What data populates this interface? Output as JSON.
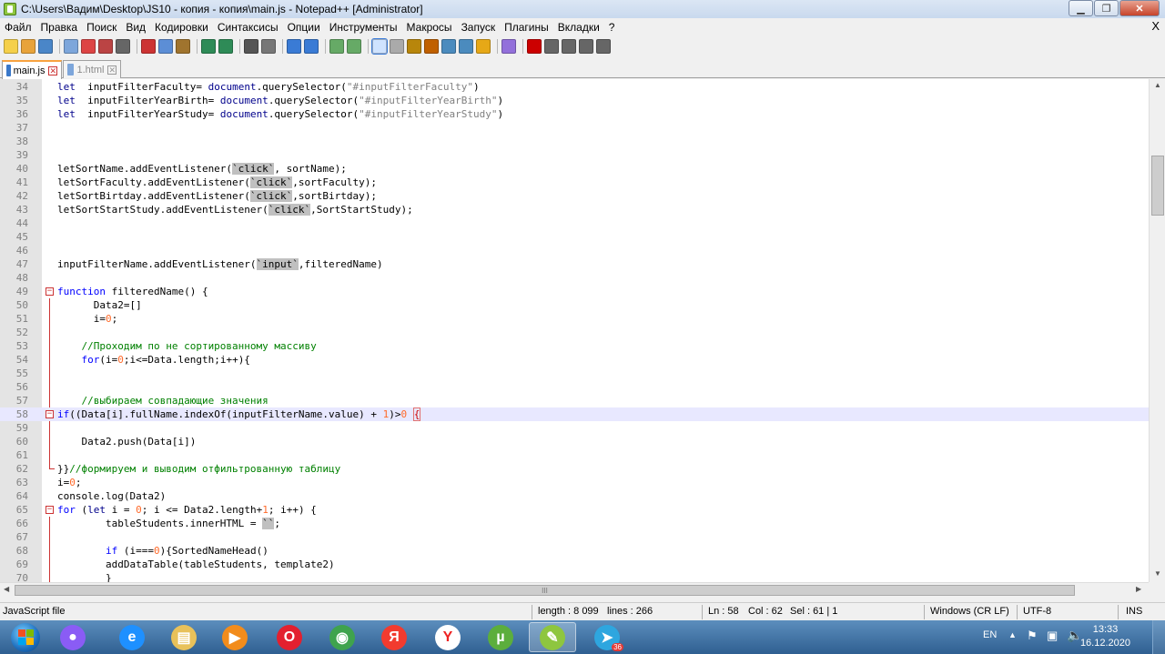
{
  "window": {
    "title": "C:\\Users\\Вадим\\Desktop\\JS10 - копия - копия\\main.js - Notepad++ [Administrator]",
    "minimize_glyph": "▁",
    "maximize_glyph": "❐",
    "close_glyph": "✕"
  },
  "menu": {
    "items": [
      "Файл",
      "Правка",
      "Поиск",
      "Вид",
      "Кодировки",
      "Синтаксисы",
      "Опции",
      "Инструменты",
      "Макросы",
      "Запуск",
      "Плагины",
      "Вкладки",
      "?"
    ],
    "close_glyph": "X"
  },
  "toolbar": {
    "icons": [
      "new-file-icon",
      "open-file-icon",
      "save-icon",
      "save-all-icon",
      "close-icon",
      "close-all-icon",
      "print-icon",
      "cut-icon",
      "copy-icon",
      "paste-icon",
      "undo-icon",
      "redo-icon",
      "find-icon",
      "replace-icon",
      "zoom-in-icon",
      "zoom-out-icon",
      "sync-vertical-icon",
      "sync-horizontal-icon",
      "word-wrap-icon",
      "show-all-chars-icon",
      "indent-guide-icon",
      "user-language-icon",
      "doc-map-icon",
      "function-list-icon",
      "folder-workspace-icon",
      "monitoring-icon",
      "record-macro-icon",
      "stop-record-icon",
      "play-macro-icon",
      "run-macro-multiple-icon",
      "save-macro-icon"
    ]
  },
  "tabs": [
    {
      "label": "main.js",
      "active": true
    },
    {
      "label": "1.html",
      "active": false
    }
  ],
  "editor": {
    "lines": [
      {
        "n": "34",
        "segs": [
          [
            "kw",
            "let"
          ],
          [
            "",
            "  inputFilterFaculty= "
          ],
          [
            "kw",
            "document"
          ],
          [
            "",
            ".querySelector("
          ],
          [
            "str",
            "\"#inputFilterFaculty\""
          ],
          [
            "",
            ")"
          ]
        ]
      },
      {
        "n": "35",
        "segs": [
          [
            "kw",
            "let"
          ],
          [
            "",
            "  inputFilterYearBirth= "
          ],
          [
            "kw",
            "document"
          ],
          [
            "",
            ".querySelector("
          ],
          [
            "str",
            "\"#inputFilterYearBirth\""
          ],
          [
            "",
            ")"
          ]
        ]
      },
      {
        "n": "36",
        "segs": [
          [
            "kw",
            "let"
          ],
          [
            "",
            "  inputFilterYearStudy= "
          ],
          [
            "kw",
            "document"
          ],
          [
            "",
            ".querySelector("
          ],
          [
            "str",
            "\"#inputFilterYearStudy\""
          ],
          [
            "",
            ")"
          ]
        ]
      },
      {
        "n": "37",
        "segs": []
      },
      {
        "n": "38",
        "segs": []
      },
      {
        "n": "39",
        "segs": []
      },
      {
        "n": "40",
        "segs": [
          [
            "",
            "letSortName.addEventListener("
          ],
          [
            "hl",
            "`click`"
          ],
          [
            "",
            ", sortName);"
          ]
        ]
      },
      {
        "n": "41",
        "segs": [
          [
            "",
            "letSortFaculty.addEventListener("
          ],
          [
            "hl",
            "`click`"
          ],
          [
            "",
            ",sortFaculty);"
          ]
        ]
      },
      {
        "n": "42",
        "segs": [
          [
            "",
            "letSortBirtday.addEventListener("
          ],
          [
            "hl",
            "`click`"
          ],
          [
            "",
            ",sortBirtday);"
          ]
        ]
      },
      {
        "n": "43",
        "segs": [
          [
            "",
            "letSortStartStudy.addEventListener("
          ],
          [
            "hl",
            "`click`"
          ],
          [
            "",
            ",SortStartStudy);"
          ]
        ]
      },
      {
        "n": "44",
        "segs": []
      },
      {
        "n": "45",
        "segs": []
      },
      {
        "n": "46",
        "segs": []
      },
      {
        "n": "47",
        "segs": [
          [
            "",
            "inputFilterName.addEventListener("
          ],
          [
            "hl",
            "`input`"
          ],
          [
            "",
            ",filteredName)"
          ]
        ]
      },
      {
        "n": "48",
        "segs": []
      },
      {
        "n": "49",
        "fold": "open",
        "segs": [
          [
            "kw2",
            "function"
          ],
          [
            "",
            " filteredName() {"
          ]
        ]
      },
      {
        "n": "50",
        "guide": true,
        "segs": [
          [
            "",
            "      Data2=[]"
          ]
        ]
      },
      {
        "n": "51",
        "guide": true,
        "segs": [
          [
            "",
            "      i="
          ],
          [
            "num",
            "0"
          ],
          [
            "",
            ";"
          ]
        ]
      },
      {
        "n": "52",
        "guide": true,
        "segs": []
      },
      {
        "n": "53",
        "guide": true,
        "segs": [
          [
            "cmt",
            "    //Проходим по не сортированному массиву"
          ]
        ]
      },
      {
        "n": "54",
        "guide": true,
        "segs": [
          [
            "kw2",
            "    for"
          ],
          [
            "",
            "(i="
          ],
          [
            "num",
            "0"
          ],
          [
            "",
            ";i<=Data.length;i++){"
          ]
        ]
      },
      {
        "n": "55",
        "guide": true,
        "segs": []
      },
      {
        "n": "56",
        "guide": true,
        "segs": []
      },
      {
        "n": "57",
        "guide": true,
        "segs": [
          [
            "cmt",
            "    //выбираем совпадающие значения"
          ]
        ]
      },
      {
        "n": "58",
        "fold": "open",
        "current": true,
        "segs": [
          [
            "kw2",
            "if"
          ],
          [
            "",
            "((Data[i].fullName.indexOf(inputFilterName.value) + "
          ],
          [
            "num",
            "1"
          ],
          [
            "",
            ")>"
          ],
          [
            "num",
            "0"
          ],
          [
            "",
            " "
          ],
          [
            "br",
            "{"
          ]
        ]
      },
      {
        "n": "59",
        "guide": true,
        "segs": []
      },
      {
        "n": "60",
        "guide": true,
        "segs": [
          [
            "",
            "    Data2.push(Data[i])"
          ]
        ]
      },
      {
        "n": "61",
        "guide": true,
        "segs": []
      },
      {
        "n": "62",
        "end": true,
        "segs": [
          [
            "",
            "}}"
          ],
          [
            "cmt",
            "//формируем и выводим отфильтрованную таблицу"
          ]
        ]
      },
      {
        "n": "63",
        "segs": [
          [
            "",
            "i="
          ],
          [
            "num",
            "0"
          ],
          [
            "",
            ";"
          ]
        ]
      },
      {
        "n": "64",
        "segs": [
          [
            "",
            "console.log(Data2)"
          ]
        ]
      },
      {
        "n": "65",
        "fold": "open",
        "segs": [
          [
            "kw2",
            "for"
          ],
          [
            "",
            " ("
          ],
          [
            "kw",
            "let"
          ],
          [
            "",
            " i = "
          ],
          [
            "num",
            "0"
          ],
          [
            "",
            "; i <= Data2.length+"
          ],
          [
            "num",
            "1"
          ],
          [
            "",
            "; i++) {"
          ]
        ]
      },
      {
        "n": "66",
        "guide": true,
        "segs": [
          [
            "",
            "        tableStudents.innerHTML = "
          ],
          [
            "hl",
            "``"
          ],
          [
            "",
            ";"
          ]
        ]
      },
      {
        "n": "67",
        "guide": true,
        "segs": []
      },
      {
        "n": "68",
        "guide": true,
        "segs": [
          [
            "kw2",
            "        if"
          ],
          [
            "",
            " (i==="
          ],
          [
            "num",
            "0"
          ],
          [
            "",
            "){SortedNameHead()"
          ]
        ]
      },
      {
        "n": "69",
        "guide": true,
        "segs": [
          [
            "",
            "        addDataTable(tableStudents, template2)"
          ]
        ]
      },
      {
        "n": "70",
        "guide": true,
        "segs": [
          [
            "",
            "        }"
          ]
        ]
      }
    ]
  },
  "hscroll": {
    "grip": "III"
  },
  "status": {
    "file_type": "JavaScript file",
    "length": "length : 8 099",
    "lines": "lines : 266",
    "ln": "Ln : 58",
    "col": "Col : 62",
    "sel": "Sel : 61 | 1",
    "eol": "Windows (CR LF)",
    "encoding": "UTF-8",
    "mode": "INS"
  },
  "taskbar": {
    "apps": [
      {
        "name": "alice-icon",
        "color": "#8a5cf5",
        "glyph": "●"
      },
      {
        "name": "internet-explorer-icon",
        "color": "#1e90ff",
        "glyph": "e"
      },
      {
        "name": "file-explorer-icon",
        "color": "#e8c15a",
        "glyph": "▤"
      },
      {
        "name": "media-player-icon",
        "color": "#f28c1c",
        "glyph": "▶"
      },
      {
        "name": "opera-icon",
        "color": "#e3202f",
        "glyph": "O"
      },
      {
        "name": "chrome-icon",
        "color": "#3fa34d",
        "glyph": "◉"
      },
      {
        "name": "yandex-icon",
        "color": "#f23b2f",
        "glyph": "Я"
      },
      {
        "name": "yandex-browser-icon",
        "color": "#ffffff",
        "glyph": "Y"
      },
      {
        "name": "utorrent-icon",
        "color": "#5cae3c",
        "glyph": "µ"
      },
      {
        "name": "notepad-plus-plus-icon",
        "color": "#8ec63f",
        "glyph": "✎"
      },
      {
        "name": "telegram-icon",
        "color": "#2ea6df",
        "glyph": "➤"
      }
    ],
    "telegram_badge": "36",
    "lang": "EN",
    "time": "13:33",
    "date": "16.12.2020"
  }
}
